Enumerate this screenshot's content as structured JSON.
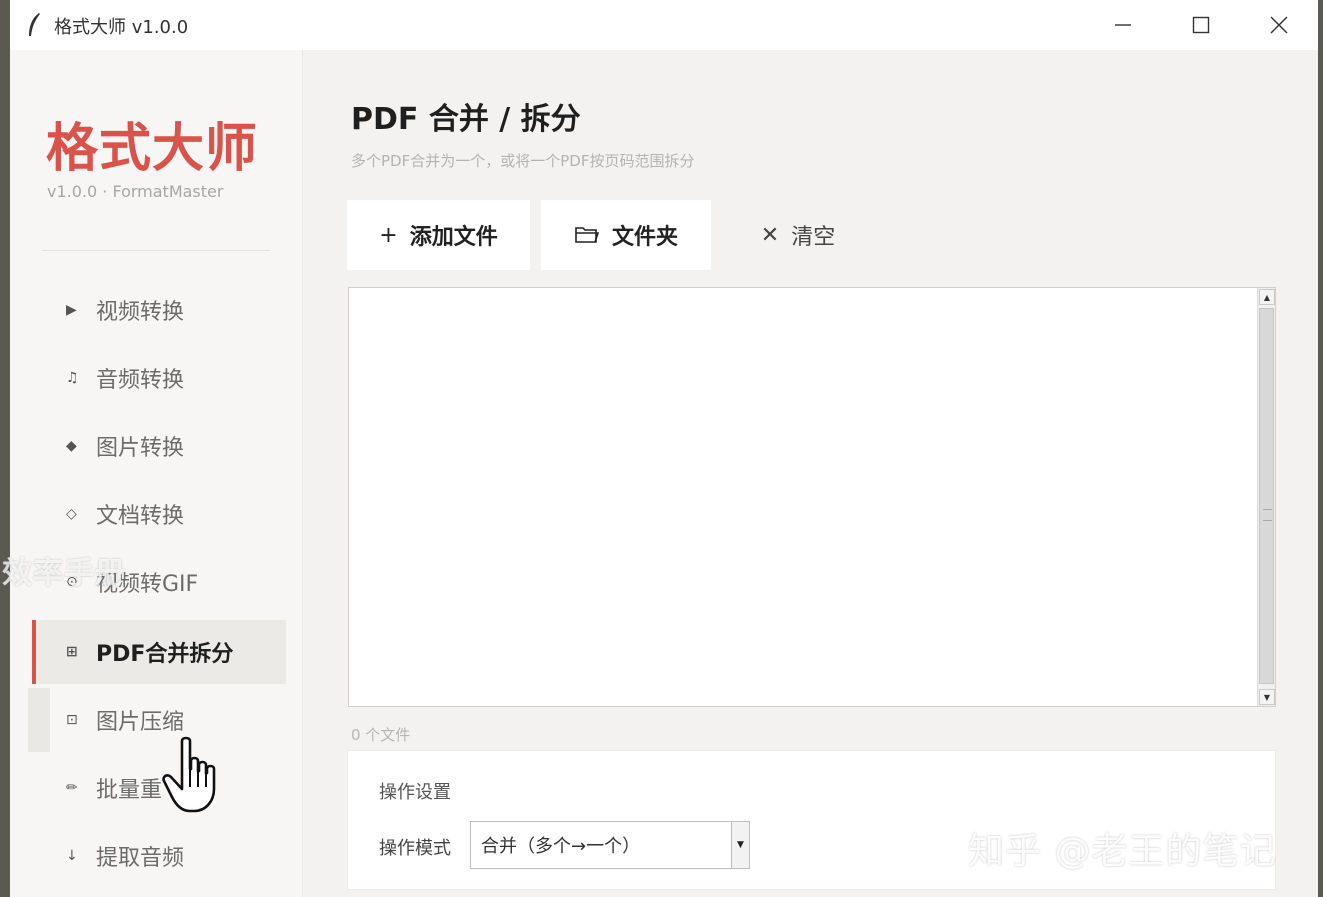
{
  "window": {
    "title": "格式大师 v1.0.0"
  },
  "sidebar": {
    "brand": "格式大师",
    "version": "v1.0.0 · FormatMaster",
    "items": [
      {
        "icon": "▶",
        "label": "视频转换"
      },
      {
        "icon": "♫",
        "label": "音频转换"
      },
      {
        "icon": "◆",
        "label": "图片转换"
      },
      {
        "icon": "◇",
        "label": "文档转换"
      },
      {
        "icon": "⊙",
        "label": "视频转GIF"
      },
      {
        "icon": "⊞",
        "label": "PDF合并拆分"
      },
      {
        "icon": "⊡",
        "label": "图片压缩"
      },
      {
        "icon": "✏",
        "label": "批量重"
      },
      {
        "icon": "↓",
        "label": "提取音频"
      }
    ],
    "active_index": 5
  },
  "main": {
    "title": "PDF 合并 / 拆分",
    "subtitle": "多个PDF合并为一个，或将一个PDF按页码范围拆分",
    "add_file_label": "添加文件",
    "add_file_icon": "+",
    "folder_label": "文件夹",
    "clear_label": "清空",
    "clear_icon": "✕",
    "file_count": "0 个文件",
    "settings": {
      "title": "操作设置",
      "mode_label": "操作模式",
      "mode_value": "合并（多个→一个）"
    }
  },
  "overlays": {
    "watermark_left": "效率手册",
    "watermark_right": "知乎 @老王的笔记"
  },
  "colors": {
    "accent": "#d9534a",
    "sidebar_bg": "#f7f6f4",
    "main_bg": "#f3f2f0"
  }
}
